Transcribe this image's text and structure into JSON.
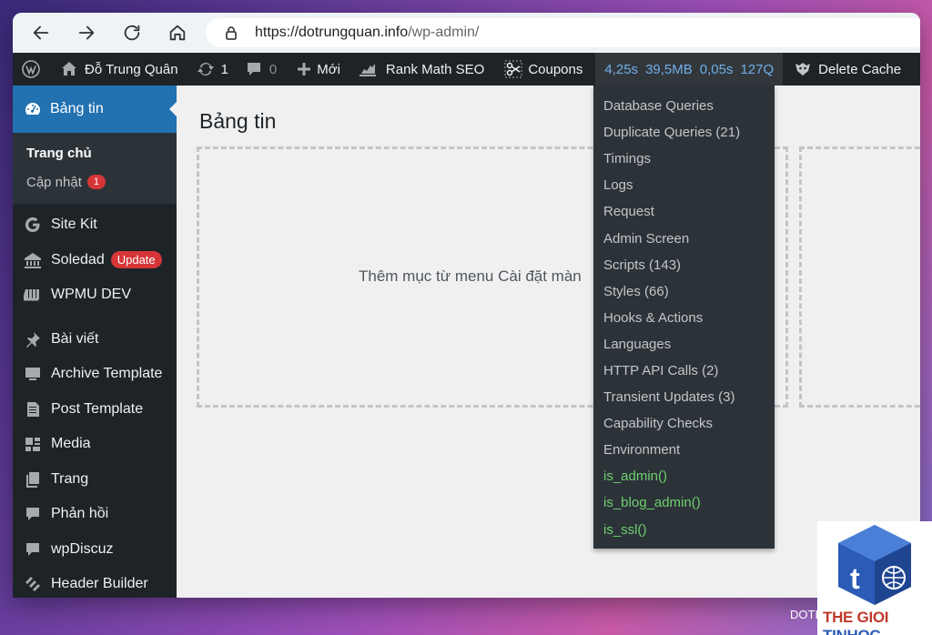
{
  "browser": {
    "url_host": "https://dotrungquan.info",
    "url_path": "/wp-admin/"
  },
  "admin_bar": {
    "site_name": "Đỗ Trung Quân",
    "updates_count": "1",
    "comments_count": "0",
    "new_label": "Mới",
    "rank_math_label": "Rank Math SEO",
    "coupons_label": "Coupons",
    "qm_time": "4,25s",
    "qm_memory": "39,5MB",
    "qm_db_time": "0,05s",
    "qm_queries": "127Q",
    "delete_cache_label": "Delete Cache"
  },
  "sidebar": {
    "dashboard_label": "Bảng tin",
    "submenu": [
      {
        "label": "Trang chủ"
      },
      {
        "label": "Cập nhật",
        "badge": "1"
      }
    ],
    "items": [
      {
        "label": "Site Kit",
        "icon": "google-g-icon"
      },
      {
        "label": "Soledad",
        "icon": "soledad-icon",
        "badge": "Update"
      },
      {
        "label": "WPMU DEV",
        "icon": "wpmudev-icon"
      },
      {
        "label": "Bài viết",
        "icon": "pin-icon"
      },
      {
        "label": "Archive Template",
        "icon": "archive-icon"
      },
      {
        "label": "Post Template",
        "icon": "post-template-icon"
      },
      {
        "label": "Media",
        "icon": "media-icon"
      },
      {
        "label": "Trang",
        "icon": "pages-icon"
      },
      {
        "label": "Phản hồi",
        "icon": "comments-icon"
      },
      {
        "label": "wpDiscuz",
        "icon": "wpdiscuz-icon"
      },
      {
        "label": "Header Builder",
        "icon": "header-builder-icon"
      }
    ]
  },
  "main": {
    "page_title": "Bảng tin",
    "empty_text": "Thêm mục từ menu Cài đặt màn"
  },
  "qm_menu": [
    "Database Queries",
    "Duplicate Queries (21)",
    "Timings",
    "Logs",
    "Request",
    "Admin Screen",
    "Scripts (143)",
    "Styles (66)",
    "Hooks & Actions",
    "Languages",
    "HTTP API Calls (2)",
    "Transient Updates (3)",
    "Capability Checks",
    "Environment",
    "is_admin()",
    "is_blog_admin()",
    "is_ssl()"
  ],
  "watermark": {
    "brand_red": "THE GIOI",
    "brand_blue": "TINHOC",
    "domain_partial": "DOTR"
  }
}
